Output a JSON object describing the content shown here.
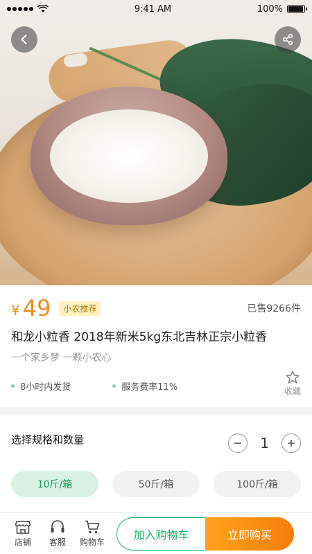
{
  "status_bar": {
    "time": "9:41 AM",
    "battery": "100%",
    "battery_level": 1.0
  },
  "product": {
    "currency": "¥",
    "price": "49",
    "tag": "小农推荐",
    "sold": "已售9266件",
    "title": "和龙小粒香 2018年新米5kg东北吉林正宗小粒香",
    "subtitle": "一个家乡梦 一颗小农心",
    "features": [
      "8小时内发货",
      "服务费率11%"
    ],
    "favorite_label": "收藏"
  },
  "spec": {
    "title": "选择规格和数量",
    "quantity": "1",
    "options": [
      "10斤/箱",
      "50斤/箱",
      "100斤/箱"
    ],
    "selected_index": 0
  },
  "bottom_bar": {
    "nav": [
      {
        "label": "店铺",
        "icon": "store-icon"
      },
      {
        "label": "客服",
        "icon": "headset-icon"
      },
      {
        "label": "购物车",
        "icon": "cart-icon"
      }
    ],
    "add_to_cart": "加入购物车",
    "buy_now": "立即购买"
  },
  "colors": {
    "accent": "#1bb36a",
    "price": "#f08a1c",
    "buy": "#f57e0c"
  }
}
